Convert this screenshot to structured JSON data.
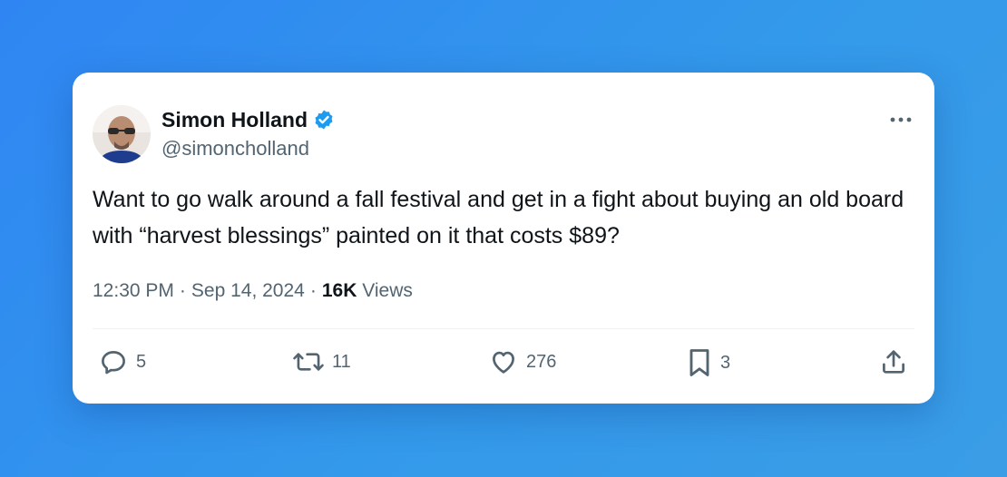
{
  "user": {
    "display_name": "Simon Holland",
    "handle": "@simoncholland",
    "verified": true
  },
  "tweet": {
    "text": "Want to go walk around a fall festival and get in a fight about buying an old board with “harvest blessings” painted on it that costs $89?",
    "time": "12:30 PM",
    "separator": "·",
    "date": "Sep 14, 2024",
    "views_count": "16K",
    "views_label": "Views"
  },
  "actions": {
    "replies": "5",
    "reposts": "11",
    "likes": "276",
    "bookmarks": "3"
  },
  "colors": {
    "verified": "#1d9bf0",
    "text_primary": "#0f1419",
    "text_secondary": "#536471",
    "background": "#2f86f3"
  },
  "icons": [
    "verified-badge-icon",
    "more-icon",
    "reply-icon",
    "repost-icon",
    "like-icon",
    "bookmark-icon",
    "share-icon"
  ]
}
